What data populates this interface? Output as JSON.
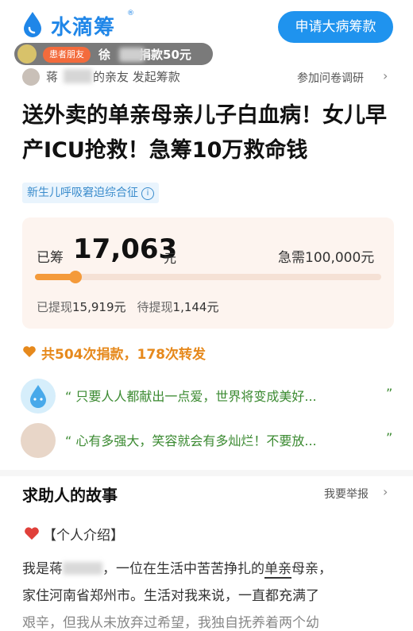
{
  "header": {
    "logo_text": "水滴筹",
    "logo_reg": "®",
    "apply_button": "申请大病筹款",
    "ticker_badge": "患者朋友",
    "ticker_prefix": "徐",
    "ticker_suffix": "捐款50元"
  },
  "initiator": {
    "prefix": "蒋",
    "suffix": "的亲友 发起筹款",
    "survey_link": "参加问卷调研",
    "arrow": "›"
  },
  "campaign": {
    "title": "送外卖的单亲母亲儿子白血病！女儿早产ICU抢救！急筹10万救命钱",
    "tag": "新生儿呼吸窘迫综合征",
    "tag_info": "i"
  },
  "funding": {
    "raised_label": "已筹",
    "raised_amount": "17,063",
    "raised_unit": "元",
    "target_text": "急需100,000元",
    "progress_fraction": 0.17063,
    "withdrawn_label": "已提现",
    "withdrawn_amount": "15,919元",
    "pending_label": "待提现",
    "pending_amount": "1,144元",
    "accent_color": "#f49a3a"
  },
  "stats": {
    "text": "共504次捐款，178次转发",
    "color": "#e6891c"
  },
  "messages": [
    {
      "text": "“ 只要人人都献出一点爱，世界将变成美好...",
      "close": "”"
    },
    {
      "text": "“ 心有多强大，笑容就会有多灿烂！不要放...",
      "close": "”"
    }
  ],
  "story": {
    "title": "求助人的故事",
    "report_link": "我要举报",
    "report_arrow": "›",
    "intro_label": "【个人介绍】",
    "line1_a": "我是蒋",
    "line1_b": "，一位在生活中苦苦挣扎的",
    "line1_c": "单亲",
    "line1_d": "母亲，",
    "line2": "家住河南省郑州市。生活对我来说，一直都充满了",
    "line3": "艰辛，但我从未放弃过希望，我独自抚养着两个幼"
  }
}
